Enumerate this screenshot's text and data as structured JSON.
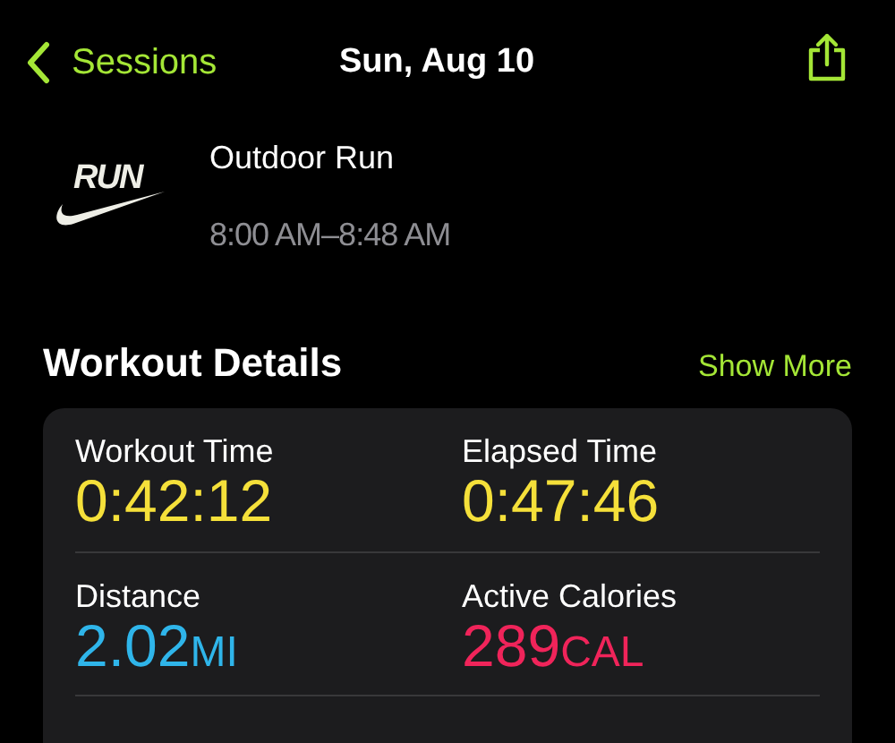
{
  "nav": {
    "back_label": "Sessions",
    "title": "Sun, Aug 10"
  },
  "workout": {
    "logo_text": "RUN",
    "name": "Outdoor Run",
    "time_range": "8:00 AM–8:48 AM"
  },
  "section": {
    "title": "Workout Details",
    "action": "Show More"
  },
  "metrics": [
    {
      "label": "Workout Time",
      "value": "0:42:12",
      "color": "#f5e03a"
    },
    {
      "label": "Elapsed Time",
      "value": "0:47:46",
      "color": "#f5e03a"
    },
    {
      "label": "Distance",
      "value": "2.02",
      "unit": "MI",
      "color": "#2fb5ea"
    },
    {
      "label": "Active Calories",
      "value": "289",
      "unit": "CAL",
      "color": "#f0245a"
    }
  ]
}
